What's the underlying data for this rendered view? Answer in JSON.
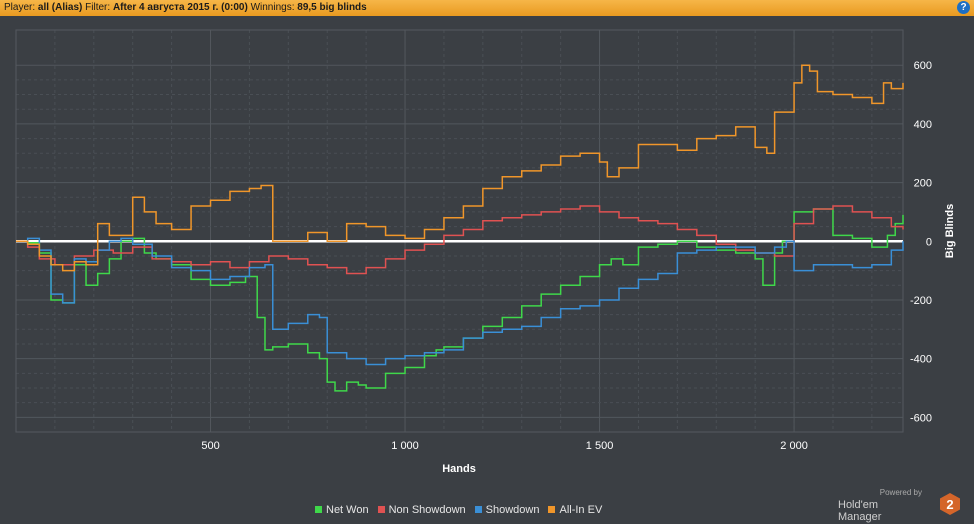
{
  "header": {
    "player_label": "Player:",
    "player_value": "all (Alias)",
    "filter_label": "Filter:",
    "filter_value": "After 4 августа 2015 г. (0:00)",
    "winnings_label": "Winnings:",
    "winnings_value": "89,5 big blinds",
    "help_glyph": "?"
  },
  "brand": {
    "powered_by": "Powered by",
    "name": "Hold'em Manager",
    "logo_text": "2"
  },
  "chart_data": {
    "type": "line",
    "xlabel": "Hands",
    "ylabel": "Big Blinds",
    "xlim": [
      0,
      2280
    ],
    "ylim": [
      -650,
      720
    ],
    "x_ticks": [
      500,
      1000,
      1500,
      2000
    ],
    "x_tick_labels": [
      "500",
      "1 000",
      "1 500",
      "2 000"
    ],
    "y_ticks": [
      600,
      400,
      200,
      0,
      -200,
      -400,
      -600
    ],
    "y_tick_labels": [
      "600",
      "400",
      "200",
      "0",
      "-200",
      "-400",
      "-600"
    ],
    "grid": true,
    "legend_position": "bottom",
    "colors": {
      "background": "#3b3f44",
      "grid": "#4a4f55",
      "zero_line": "#ffffff",
      "header_bar": "#f0a830"
    },
    "series": [
      {
        "name": "Net Won",
        "color": "#3fd84a",
        "x": [
          0,
          30,
          60,
          90,
          120,
          150,
          180,
          210,
          240,
          270,
          300,
          330,
          360,
          400,
          450,
          500,
          550,
          590,
          620,
          640,
          660,
          700,
          750,
          780,
          800,
          820,
          850,
          880,
          900,
          950,
          1000,
          1050,
          1080,
          1100,
          1150,
          1200,
          1250,
          1300,
          1350,
          1400,
          1450,
          1500,
          1530,
          1560,
          1600,
          1650,
          1700,
          1750,
          1800,
          1850,
          1900,
          1920,
          1950,
          1970,
          2000,
          2050,
          2100,
          2150,
          2200,
          2240,
          2260,
          2280
        ],
        "values": [
          0,
          -5,
          -40,
          -200,
          -210,
          -80,
          -150,
          -110,
          -60,
          0,
          10,
          -40,
          -60,
          -80,
          -130,
          -150,
          -140,
          -120,
          -260,
          -370,
          -360,
          -350,
          -380,
          -400,
          -480,
          -510,
          -480,
          -490,
          -500,
          -450,
          -430,
          -390,
          -370,
          -360,
          -330,
          -290,
          -260,
          -220,
          -180,
          -150,
          -120,
          -80,
          -60,
          -80,
          -20,
          -10,
          0,
          -20,
          -30,
          -40,
          -60,
          -150,
          -40,
          0,
          100,
          110,
          20,
          10,
          -20,
          20,
          60,
          90
        ]
      },
      {
        "name": "Non Showdown",
        "color": "#e05252",
        "x": [
          0,
          30,
          60,
          100,
          150,
          200,
          250,
          300,
          350,
          400,
          450,
          500,
          550,
          600,
          650,
          700,
          750,
          800,
          850,
          900,
          950,
          1000,
          1050,
          1100,
          1150,
          1200,
          1250,
          1300,
          1350,
          1400,
          1450,
          1500,
          1550,
          1600,
          1650,
          1700,
          1750,
          1800,
          1850,
          1900,
          1950,
          2000,
          2050,
          2100,
          2150,
          2200,
          2250,
          2280
        ],
        "values": [
          0,
          -20,
          -60,
          -80,
          -50,
          -30,
          -40,
          -20,
          -60,
          -70,
          -80,
          -70,
          -90,
          -70,
          -50,
          -60,
          -80,
          -90,
          -110,
          -90,
          -60,
          -30,
          -10,
          20,
          40,
          70,
          80,
          90,
          100,
          110,
          120,
          100,
          80,
          70,
          60,
          40,
          20,
          -10,
          -30,
          -40,
          -50,
          60,
          110,
          120,
          100,
          80,
          50,
          40
        ]
      },
      {
        "name": "Showdown",
        "color": "#3a8fd6",
        "x": [
          0,
          30,
          60,
          90,
          120,
          150,
          180,
          210,
          240,
          270,
          300,
          350,
          400,
          450,
          500,
          550,
          600,
          640,
          660,
          700,
          750,
          780,
          800,
          850,
          900,
          950,
          1000,
          1050,
          1100,
          1150,
          1200,
          1250,
          1300,
          1350,
          1400,
          1450,
          1500,
          1550,
          1600,
          1650,
          1700,
          1750,
          1800,
          1850,
          1900,
          1950,
          1980,
          2000,
          2050,
          2100,
          2150,
          2200,
          2250,
          2280
        ],
        "values": [
          0,
          10,
          -30,
          -180,
          -210,
          -60,
          -70,
          -30,
          0,
          10,
          -10,
          -50,
          -90,
          -100,
          -130,
          -120,
          -90,
          -80,
          -300,
          -280,
          -250,
          -260,
          -380,
          -400,
          -420,
          -400,
          -390,
          -380,
          -370,
          -330,
          -310,
          -300,
          -290,
          -260,
          -230,
          -220,
          -200,
          -160,
          -130,
          -110,
          -40,
          -30,
          -20,
          -20,
          -40,
          -20,
          0,
          -100,
          -80,
          -80,
          -90,
          -80,
          -30,
          0
        ]
      },
      {
        "name": "All-In EV",
        "color": "#f0962a",
        "x": [
          0,
          30,
          60,
          90,
          120,
          150,
          180,
          210,
          240,
          270,
          300,
          330,
          360,
          400,
          450,
          500,
          550,
          600,
          630,
          660,
          700,
          750,
          800,
          850,
          900,
          950,
          1000,
          1050,
          1100,
          1150,
          1200,
          1250,
          1300,
          1350,
          1400,
          1450,
          1500,
          1520,
          1550,
          1600,
          1650,
          1700,
          1750,
          1800,
          1850,
          1900,
          1930,
          1950,
          2000,
          2020,
          2040,
          2060,
          2100,
          2150,
          2200,
          2230,
          2250,
          2280
        ],
        "values": [
          0,
          -10,
          -50,
          -80,
          -100,
          -70,
          -80,
          60,
          20,
          20,
          150,
          100,
          60,
          40,
          120,
          140,
          170,
          180,
          190,
          0,
          0,
          30,
          0,
          60,
          50,
          20,
          10,
          40,
          80,
          120,
          180,
          220,
          240,
          260,
          290,
          300,
          270,
          220,
          250,
          330,
          330,
          310,
          350,
          360,
          390,
          320,
          300,
          440,
          540,
          600,
          580,
          510,
          500,
          490,
          470,
          540,
          520,
          540
        ]
      }
    ]
  }
}
